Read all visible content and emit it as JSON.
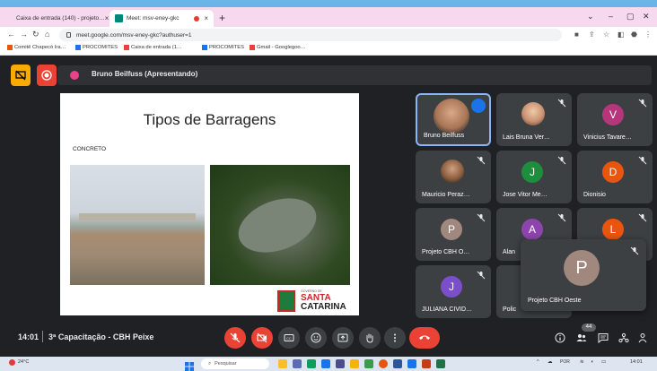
{
  "browser": {
    "tabs": [
      {
        "label": "Caixa de entrada (140) - projeto…",
        "active": false
      },
      {
        "label": "Meet: msv-eney-gkc",
        "active": true
      }
    ],
    "new_tab": "+",
    "url": "meet.google.com/msv-eney-gkc?authuser=1",
    "bookmarks": [
      "Comitê Chapecó Ira…",
      "PROCOMITES",
      "Caixa de entrada (1…",
      "PROCOMITES",
      "Gmail - Googlegoo…"
    ]
  },
  "meet": {
    "presenting_label": "Bruno Beilfuss (Apresentando)",
    "slide": {
      "title": "Tipos de Barragens",
      "subtitle": "CONCRETO",
      "logo_small": "GOVERNO DE",
      "logo_line1": "SANTA",
      "logo_line2": "CATARINA"
    },
    "participants": [
      {
        "name": "Bruno Beilfuss",
        "type": "photo",
        "active": true
      },
      {
        "name": "Lais Bruna Ver…",
        "type": "photo"
      },
      {
        "name": "Vinicius Tavare…",
        "initial": "V",
        "color": "#b5367a"
      },
      {
        "name": "Mauricio Peraz…",
        "type": "photo"
      },
      {
        "name": "Jose Vitor Me…",
        "initial": "J",
        "color": "#1e8e3e"
      },
      {
        "name": "Dionisio",
        "initial": "D",
        "color": "#e8550e"
      },
      {
        "name": "Projeto CBH O…",
        "initial": "P",
        "color": "#a1887f"
      },
      {
        "name": "Alan",
        "initial": "A",
        "color": "#8e44ad"
      },
      {
        "name": "",
        "initial": "L",
        "color": "#e8550e"
      },
      {
        "name": "JULIANA CIVID…",
        "initial": "J",
        "color": "#7b4fc9"
      },
      {
        "name": "Polic",
        "initial": "",
        "color": "#3c4043"
      }
    ],
    "floating_tile": {
      "name": "Projeto CBH Oeste",
      "initial": "P"
    },
    "time": "14:01",
    "meeting_title": "3ª Capacitação - CBH Peixe",
    "participant_count": "44",
    "colors": {
      "accent": "#1a73e8",
      "danger": "#ea4335",
      "background": "#202124"
    }
  },
  "taskbar": {
    "weather": "24°C",
    "search_placeholder": "Pesquisar",
    "language": "POR",
    "time": "14:01"
  }
}
